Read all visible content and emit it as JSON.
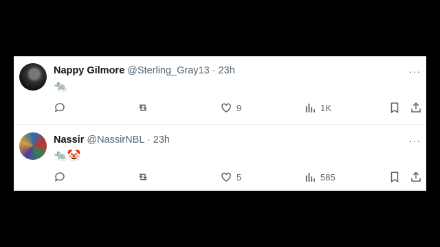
{
  "tweets": [
    {
      "name": "Nappy Gilmore",
      "handle": "@Sterling_Gray13",
      "time": "· 23h",
      "content": "🐀",
      "replies": "",
      "retweets": "",
      "likes": "9",
      "views": "1K",
      "avatar": "avatar-bw-photo"
    },
    {
      "name": "Nassir",
      "handle": "@NassirNBL",
      "time": "· 23h",
      "content": "🐀🤡",
      "replies": "",
      "retweets": "",
      "likes": "5",
      "views": "585",
      "avatar": "avatar-colorful-photo"
    }
  ],
  "more_label": "···",
  "colors": {
    "text": "#0f1419",
    "muted": "#536471",
    "background": "#000000",
    "card": "#ffffff"
  },
  "icons": [
    "reply-icon",
    "retweet-icon",
    "like-icon",
    "views-icon",
    "bookmark-icon",
    "share-icon"
  ]
}
